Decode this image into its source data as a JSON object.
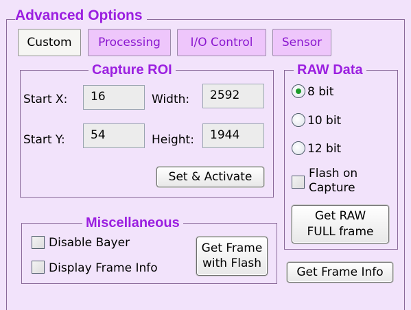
{
  "panel": {
    "title": "Advanced Options"
  },
  "tabs": [
    {
      "label": "Custom",
      "active": true
    },
    {
      "label": "Processing",
      "active": false
    },
    {
      "label": "I/O Control",
      "active": false
    },
    {
      "label": "Sensor",
      "active": false
    }
  ],
  "capture_roi": {
    "title": "Capture ROI",
    "start_x_label": "Start X:",
    "start_x_value": "16",
    "start_y_label": "Start Y:",
    "start_y_value": "54",
    "width_label": "Width:",
    "width_value": "2592",
    "height_label": "Height:",
    "height_value": "1944",
    "set_activate_label": "Set & Activate"
  },
  "raw_data": {
    "title": "RAW Data",
    "options": [
      {
        "label": "8 bit",
        "selected": true
      },
      {
        "label": "10 bit",
        "selected": false
      },
      {
        "label": "12 bit",
        "selected": false
      }
    ],
    "flash_on_capture_line1": "Flash on",
    "flash_on_capture_line2": "Capture",
    "flash_on_capture_checked": false,
    "get_raw_line1": "Get RAW",
    "get_raw_line2": "FULL frame"
  },
  "miscellaneous": {
    "title": "Miscellaneous",
    "disable_bayer_label": "Disable Bayer",
    "disable_bayer_checked": false,
    "display_frame_info_label": "Display Frame Info",
    "display_frame_info_checked": false,
    "get_frame_flash_line1": "Get Frame",
    "get_frame_flash_line2": "with Flash"
  },
  "get_frame_info_label": "Get Frame Info",
  "colors": {
    "background": "#f2e3fb",
    "accent_text": "#9b1fe0",
    "tab_inactive_bg": "#eec6fb",
    "radio_selected": "#1b9b2a"
  }
}
